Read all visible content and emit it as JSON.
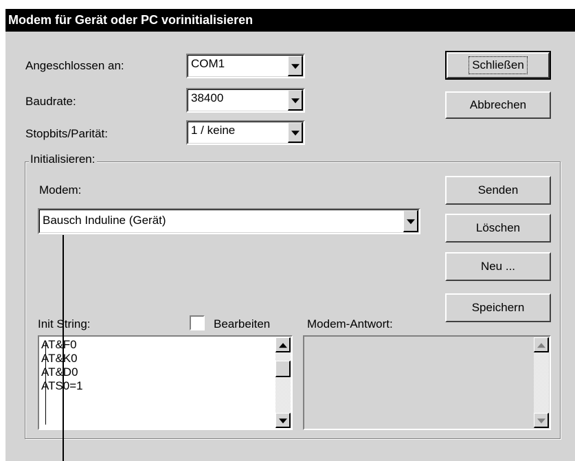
{
  "window": {
    "title": "Modem für Gerät oder PC vorinitialisieren"
  },
  "connection": {
    "port_label": "Angeschlossen an:",
    "port_value": "COM1",
    "baud_label": "Baudrate:",
    "baud_value": "38400",
    "stopbits_label": "Stopbits/Parität:",
    "stopbits_value": "1 / keine"
  },
  "buttons": {
    "close": "Schließen",
    "cancel": "Abbrechen",
    "send": "Senden",
    "delete": "Löschen",
    "new": "Neu ...",
    "save": "Speichern"
  },
  "init_group": {
    "title": "Initialisieren:",
    "modem_label": "Modem:",
    "modem_value": "Bausch Induline (Gerät)",
    "init_string_label": "Init String:",
    "edit_checkbox_label": "Bearbeiten",
    "edit_checked": false,
    "response_label": "Modem-Antwort:",
    "init_lines": [
      "AT&F0",
      "AT&K0",
      "AT&D0",
      "ATS0=1"
    ]
  },
  "icons": [
    "dropdown-arrow-icon",
    "scroll-up-arrow-icon",
    "scroll-down-arrow-icon"
  ]
}
